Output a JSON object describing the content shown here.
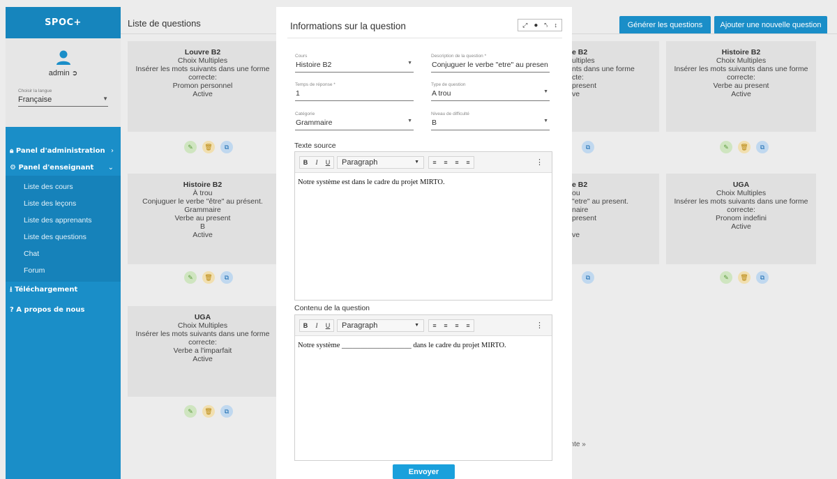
{
  "sidebar": {
    "brand": "SPOC+",
    "user": "admin",
    "language_label": "Choisir la langue",
    "language_value": "Française",
    "nav": {
      "admin_panel": "Panel d'administration",
      "teacher_panel": "Panel d'enseignant",
      "sub_items": [
        "Liste des cours",
        "Liste des leçons",
        "Liste des apprenants",
        "Liste des questions",
        "Chat",
        "Forum"
      ],
      "download": "Téléchargement",
      "about": "A propos de nous"
    }
  },
  "header": {
    "title": "Liste de questions",
    "generate_button": "Générer les questions",
    "add_button": "Ajouter une nouvelle question"
  },
  "cards": {
    "c1": [
      "Louvre B2",
      "Choix Multiples",
      "Insérer les mots suivants dans une forme",
      "correcte:",
      "Promon personnel",
      "Active"
    ],
    "c2": [
      "Histoire B2",
      "À trou",
      "Conjuguer le verbe \"être\" au présent.",
      "Grammaire",
      "Verbe au present",
      "B",
      "Active"
    ],
    "c3": [
      "UGA",
      "Choix Multiples",
      "Insérer les mots suivants dans une forme",
      "correcte:",
      "Verbe a l'imparfait",
      "Active"
    ],
    "c4": [
      "e B2",
      "ultiples",
      "nts dans une forme",
      "cte:",
      "present",
      "ve"
    ],
    "c5": [
      "e B2",
      "ou",
      "\"etre\" au present.",
      "naire",
      "present",
      "",
      "ve"
    ],
    "c6": [
      "Histoire B2",
      "Choix Multiples",
      "Insérer les mots suivants dans une forme",
      "correcte:",
      "Verbe au present",
      "Active"
    ],
    "c7": [
      "UGA",
      "Choix Multiples",
      "Insérer les mots suivants dans une forme",
      "correcte:",
      "Pronom indefini",
      "Active"
    ]
  },
  "pager": "ante »",
  "modal": {
    "title": "Informations sur la question",
    "fields": {
      "cours_label": "Cours",
      "cours_value": "Histoire B2",
      "description_label": "Description de la question *",
      "description_value": "Conjuguer le verbe \"etre\" au presen",
      "temps_label": "Temps de réponse *",
      "temps_value": "1",
      "type_label": "Type de question",
      "type_value": "A trou",
      "categorie_label": "Catégorie",
      "categorie_value": "Grammaire",
      "niveau_label": "Niveau de difficulté",
      "niveau_value": "B"
    },
    "texte_source_label": "Texte source",
    "texte_source_content": "Notre système est dans le cadre du projet MIRTO.",
    "contenu_label": "Contenu de la question",
    "contenu_content": "Notre système ___________________ dans le cadre du projet MIRTO.",
    "paragraph": "Paragraph",
    "submit": "Envoyer"
  }
}
